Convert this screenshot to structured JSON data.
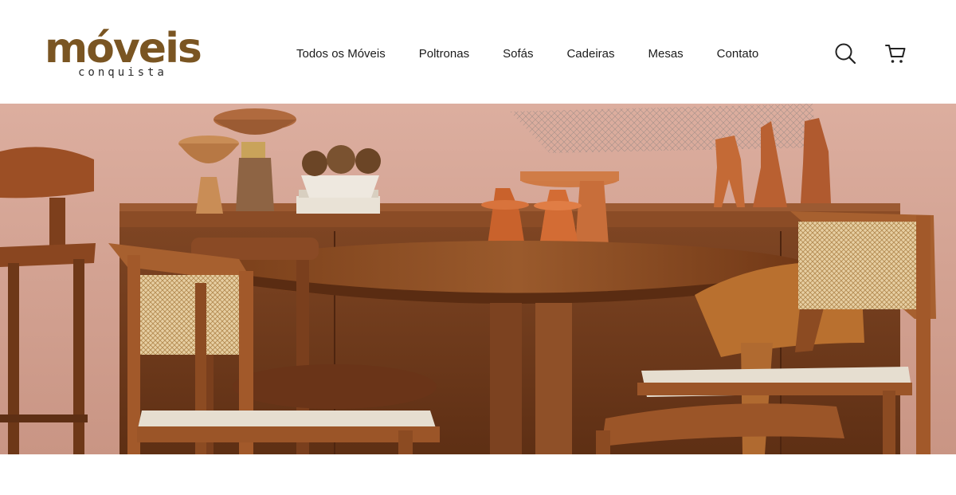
{
  "brand": {
    "name": "móveis",
    "tagline": "conquista",
    "color": "#7a5522"
  },
  "nav": {
    "items": [
      {
        "label": "Todos os Móveis"
      },
      {
        "label": "Poltronas"
      },
      {
        "label": "Sofás"
      },
      {
        "label": "Cadeiras"
      },
      {
        "label": "Mesas"
      },
      {
        "label": "Contato"
      }
    ]
  },
  "header_icons": {
    "search": "search-icon",
    "cart": "cart-icon"
  },
  "hero": {
    "image_subject": "dining room with wooden table and cane chairs",
    "wall_color": "#d7a99b",
    "wood_color": "#8a4e24"
  }
}
